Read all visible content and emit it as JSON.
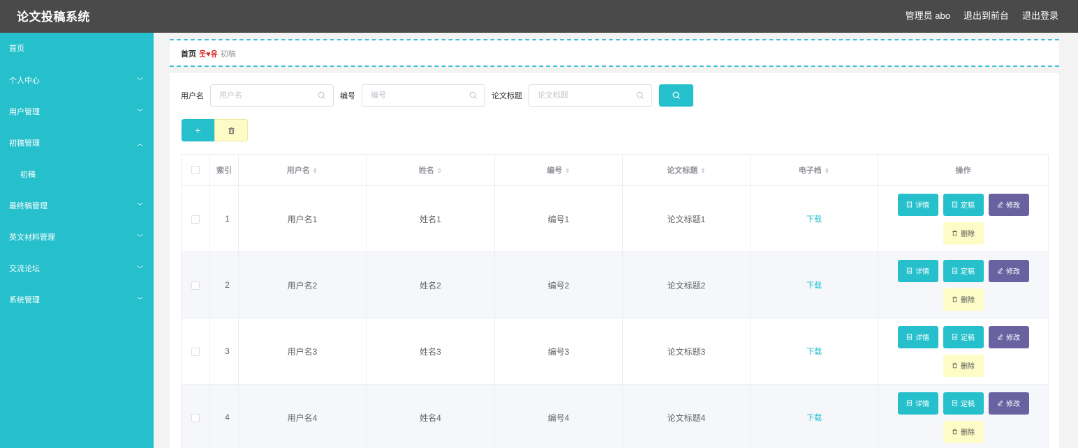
{
  "header": {
    "title": "论文投稿系统",
    "user": "管理员 abo",
    "back_to_front": "退出到前台",
    "logout": "退出登录"
  },
  "sidebar": {
    "items": [
      {
        "label": "首页",
        "chevron": ""
      },
      {
        "label": "个人中心",
        "chevron": "﹀"
      },
      {
        "label": "用户管理",
        "chevron": "﹀"
      },
      {
        "label": "初稿管理",
        "chevron": "︿"
      },
      {
        "label": "初稿",
        "chevron": ""
      },
      {
        "label": "最终稿管理",
        "chevron": "﹀"
      },
      {
        "label": "英文材料管理",
        "chevron": "﹀"
      },
      {
        "label": "交流论坛",
        "chevron": "﹀"
      },
      {
        "label": "系统管理",
        "chevron": "﹀"
      }
    ]
  },
  "breadcrumb": {
    "home": "首页",
    "separator": "웃♥유",
    "current": "初稿"
  },
  "search": {
    "username_label": "用户名",
    "username_placeholder": "用户名",
    "number_label": "编号",
    "number_placeholder": "编号",
    "title_label": "论文标题",
    "title_placeholder": "论文标题"
  },
  "toolbar": {
    "add_label": "+"
  },
  "table": {
    "columns": [
      "索引",
      "用户名",
      "姓名",
      "编号",
      "论文标题",
      "电子档",
      "操作"
    ],
    "download_label": "下载",
    "ops": {
      "detail": "详情",
      "final": "定稿",
      "edit": "修改",
      "delete": "删除"
    },
    "rows": [
      {
        "index": "1",
        "username": "用户名1",
        "name": "姓名1",
        "number": "编号1",
        "title": "论文标题1"
      },
      {
        "index": "2",
        "username": "用户名2",
        "name": "姓名2",
        "number": "编号2",
        "title": "论文标题2"
      },
      {
        "index": "3",
        "username": "用户名3",
        "name": "姓名3",
        "number": "编号3",
        "title": "论文标题3"
      },
      {
        "index": "4",
        "username": "用户名4",
        "name": "姓名4",
        "number": "编号4",
        "title": "论文标题4"
      }
    ]
  },
  "colors": {
    "accent": "#26c0cc",
    "topbar": "#4a4a4a",
    "edit_button": "#6a62a0",
    "delete_button": "#fdfbc6"
  }
}
